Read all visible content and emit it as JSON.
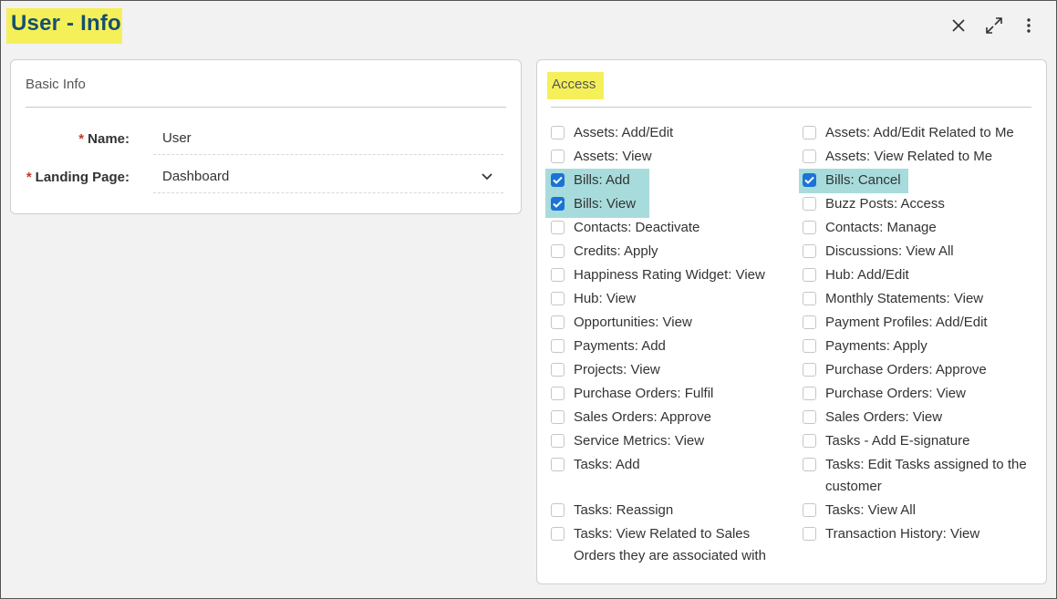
{
  "header": {
    "title": "User - Info",
    "close_icon": "close-icon",
    "expand_icon": "expand-icon",
    "more_icon": "more-vertical-icon"
  },
  "basic_info": {
    "title": "Basic Info",
    "name_label": "Name:",
    "name_value": "User",
    "landing_label": "Landing Page:",
    "landing_value": "Dashboard",
    "required_marker": "*"
  },
  "access": {
    "title": "Access",
    "left": [
      {
        "label": "Assets: Add/Edit",
        "checked": false
      },
      {
        "label": "Assets: View",
        "checked": false
      },
      {
        "label": "Bills: Add",
        "checked": true
      },
      {
        "label": "Bills: View",
        "checked": true
      },
      {
        "label": "Contacts: Deactivate",
        "checked": false
      },
      {
        "label": "Credits: Apply",
        "checked": false
      },
      {
        "label": "Happiness Rating Widget: View",
        "checked": false
      },
      {
        "label": "Hub: View",
        "checked": false
      },
      {
        "label": "Opportunities: View",
        "checked": false
      },
      {
        "label": "Payments: Add",
        "checked": false
      },
      {
        "label": "Projects: View",
        "checked": false
      },
      {
        "label": "Purchase Orders: Fulfil",
        "checked": false
      },
      {
        "label": "Sales Orders: Approve",
        "checked": false
      },
      {
        "label": "Service Metrics: View",
        "checked": false
      },
      {
        "label": "Tasks: Add",
        "checked": false
      },
      {
        "label": "Tasks: Reassign",
        "checked": false
      },
      {
        "label": "Tasks: View Related to Sales Orders they are associated with",
        "checked": false
      }
    ],
    "right": [
      {
        "label": "Assets: Add/Edit Related to Me",
        "checked": false
      },
      {
        "label": "Assets: View Related to Me",
        "checked": false
      },
      {
        "label": "Bills: Cancel",
        "checked": true
      },
      {
        "label": "Buzz Posts: Access",
        "checked": false
      },
      {
        "label": "Contacts: Manage",
        "checked": false
      },
      {
        "label": "Discussions: View All",
        "checked": false
      },
      {
        "label": "Hub: Add/Edit",
        "checked": false
      },
      {
        "label": "Monthly Statements: View",
        "checked": false
      },
      {
        "label": "Payment Profiles: Add/Edit",
        "checked": false
      },
      {
        "label": "Payments: Apply",
        "checked": false
      },
      {
        "label": "Purchase Orders: Approve",
        "checked": false
      },
      {
        "label": "Purchase Orders: View",
        "checked": false
      },
      {
        "label": "Sales Orders: View",
        "checked": false
      },
      {
        "label": "Tasks - Add E-signature",
        "checked": false
      },
      {
        "label": "Tasks: Edit Tasks assigned to the customer",
        "checked": false
      },
      {
        "label": "Tasks: View All",
        "checked": false
      },
      {
        "label": "Transaction History: View",
        "checked": false
      }
    ]
  },
  "colors": {
    "title": "#15506e",
    "highlight_yellow": "#f5f05a",
    "highlight_teal": "#a8dcdc",
    "checkbox_blue": "#1a73d6",
    "required_red": "#c0392b"
  }
}
